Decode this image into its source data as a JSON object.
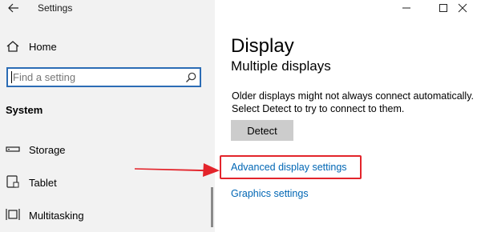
{
  "window": {
    "title": "Settings",
    "controls": {
      "minimize": "minimize",
      "maximize": "maximize",
      "close": "close"
    }
  },
  "sidebar": {
    "home_label": "Home",
    "search": {
      "placeholder": "Find a setting",
      "value": ""
    },
    "section_title": "System",
    "items": [
      {
        "label": "Storage",
        "icon": "storage-icon"
      },
      {
        "label": "Tablet",
        "icon": "tablet-icon"
      },
      {
        "label": "Multitasking",
        "icon": "multitasking-icon"
      }
    ]
  },
  "main": {
    "page_title": "Display",
    "section_title": "Multiple displays",
    "description": "Older displays might not always connect automatically. Select Detect to try to connect to them.",
    "detect_button": "Detect",
    "advanced_link": "Advanced display settings",
    "graphics_link": "Graphics settings"
  },
  "colors": {
    "sidebar_bg": "#f2f2f2",
    "link": "#0066b4",
    "search_border": "#2b6cb5",
    "annotation": "#e3242b",
    "button_bg": "#cccccc"
  }
}
